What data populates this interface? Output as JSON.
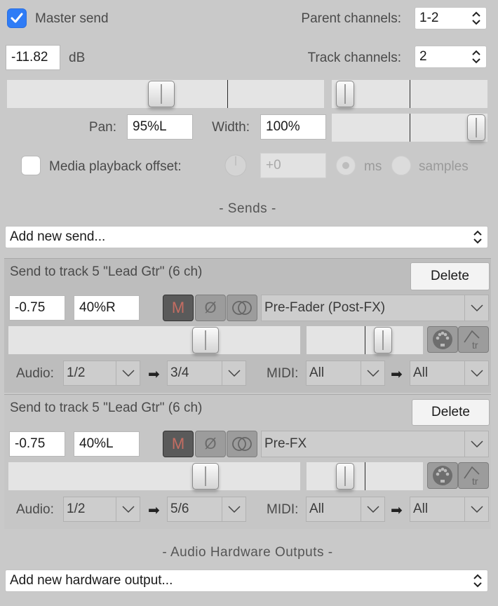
{
  "master": {
    "master_send_label": "Master send",
    "master_send_checked": true,
    "parent_channels_label": "Parent channels:",
    "parent_channels_value": "1-2",
    "volume_value": "-11.82",
    "volume_unit": "dB",
    "track_channels_label": "Track channels:",
    "track_channels_value": "2",
    "pan_label": "Pan:",
    "pan_value": "95%L",
    "width_label": "Width:",
    "width_value": "100%",
    "media_offset_label": "Media playback offset:",
    "media_offset_checked": false,
    "offset_value": "+0",
    "unit_ms_label": "ms",
    "unit_samples_label": "samples",
    "unit_selected": "ms"
  },
  "sends": {
    "section_title": "-  Sends  -",
    "add_label": "Add new send...",
    "items": [
      {
        "title": "Send to track 5 \"Lead Gtr\" (6 ch)",
        "delete_label": "Delete",
        "volume": "-0.75",
        "pan": "40%R",
        "mute_label": "M",
        "phase_glyph": "Ø",
        "mode": "Pre-Fader (Post-FX)",
        "audio_label": "Audio:",
        "audio_src": "1/2",
        "audio_dst": "3/4",
        "midi_label": "MIDI:",
        "midi_src": "All",
        "midi_dst": "All",
        "env_label": "tr"
      },
      {
        "title": "Send to track 5 \"Lead Gtr\" (6 ch)",
        "delete_label": "Delete",
        "volume": "-0.75",
        "pan": "40%L",
        "mute_label": "M",
        "phase_glyph": "Ø",
        "mode": "Pre-FX",
        "audio_label": "Audio:",
        "audio_src": "1/2",
        "audio_dst": "5/6",
        "midi_label": "MIDI:",
        "midi_src": "All",
        "midi_dst": "All",
        "env_label": "tr"
      }
    ]
  },
  "hardware": {
    "section_title": "-  Audio Hardware Outputs  -",
    "add_label": "Add new hardware output..."
  },
  "icons": {
    "checkmark": "checkmark-icon",
    "updown": "updown-chevron-icon",
    "chevron": "chevron-down-icon",
    "arrow": "arrow-right-icon",
    "midi": "midi-port-icon",
    "envelope": "envelope-icon",
    "stereo": "stereo-rings-icon"
  },
  "colors": {
    "accent": "#2f7cf6",
    "background": "#c9c9c9",
    "mute_active_bg": "#5a5a5a",
    "mute_active_text": "#c46d62"
  }
}
